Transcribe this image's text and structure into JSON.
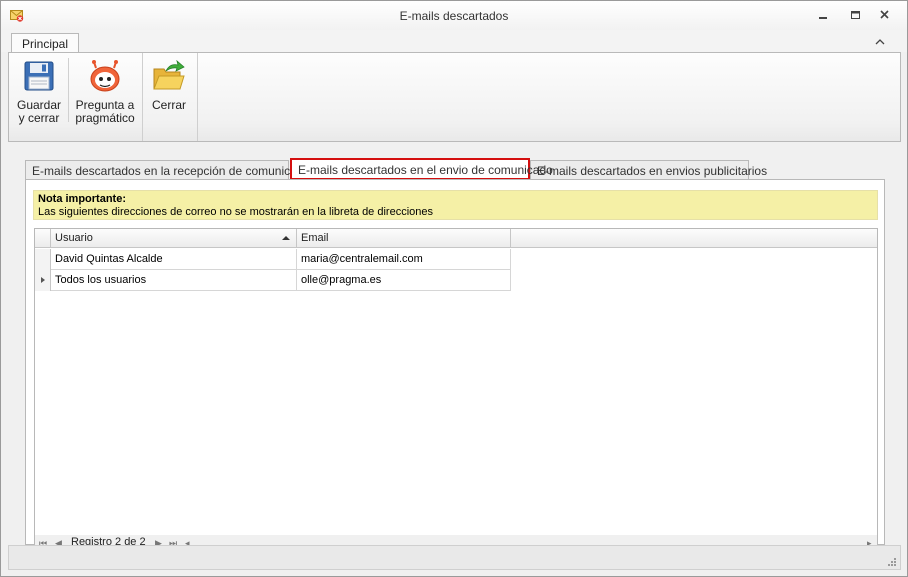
{
  "window": {
    "title": "E-mails descartados"
  },
  "ribbon": {
    "tab_label": "Principal",
    "buttons": {
      "save": {
        "label_line1": "Guardar",
        "label_line2": "y cerrar",
        "icon": "floppy-disk-icon"
      },
      "ask": {
        "label_line1": "Pregunta a",
        "label_line2": "pragmático",
        "icon": "robot-icon"
      },
      "close": {
        "label": "Cerrar",
        "icon": "open-folder-arrow-icon"
      }
    }
  },
  "tabs": [
    {
      "label": "E-mails descartados en la recepción de comunicados",
      "active": false
    },
    {
      "label": "E-mails descartados en el envio de comunicado",
      "active": true
    },
    {
      "label": "E-mails descartados en envios publicitarios",
      "active": false
    }
  ],
  "note": {
    "title": "Nota importante:",
    "text": "Las siguientes direcciones de correo no se mostrarán en la libreta de direcciones"
  },
  "grid": {
    "columns": [
      "Usuario",
      "Email"
    ],
    "sort_column": "Usuario",
    "rows": [
      {
        "usuario": "David Quintas Alcalde",
        "email": "maria@centralemail.com"
      },
      {
        "usuario": "Todos los usuarios",
        "email": "olle@pragma.es"
      }
    ],
    "navigator_text": "Registro 2 de 2"
  },
  "colors": {
    "note_background": "#f5f0a6",
    "active_tab_border": "#d40f0f"
  }
}
